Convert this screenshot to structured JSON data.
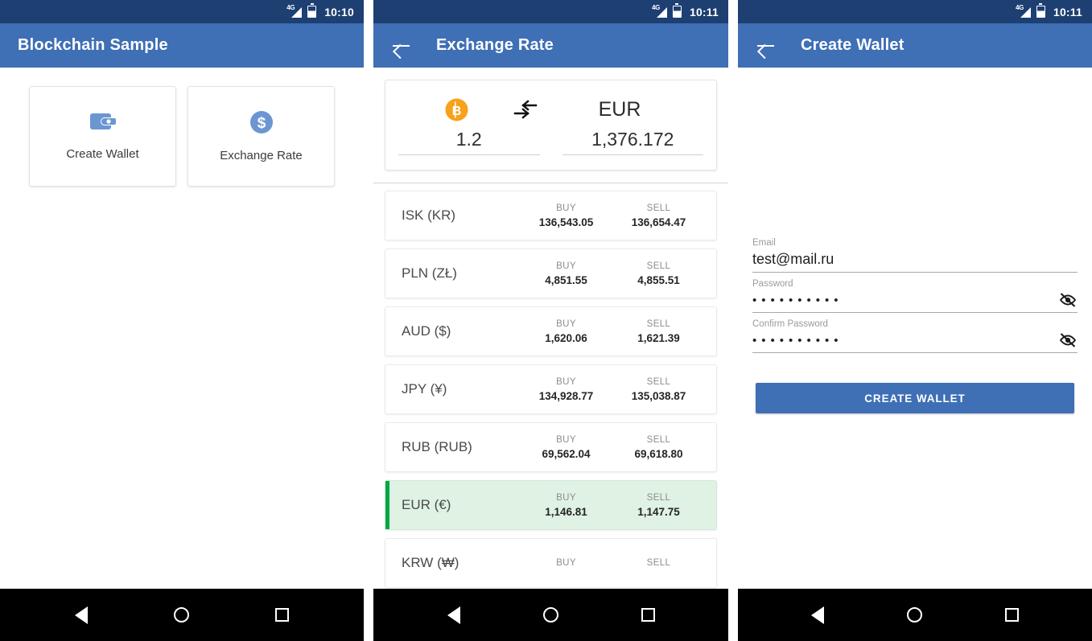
{
  "screens": {
    "home": {
      "statusbar": {
        "network": "4G",
        "time": "10:10",
        "signal_icon": "signal-4g-icon",
        "battery_icon": "battery-icon"
      },
      "appbar": {
        "title": "Blockchain Sample"
      },
      "cards": [
        {
          "label": "Create Wallet",
          "icon": "wallet-icon"
        },
        {
          "label": "Exchange Rate",
          "icon": "dollar-circle-icon"
        }
      ]
    },
    "exchange": {
      "statusbar": {
        "network": "4G",
        "time": "10:11",
        "signal_icon": "signal-4g-icon",
        "battery_icon": "battery-icon"
      },
      "appbar": {
        "title": "Exchange Rate",
        "back_icon": "back-arrow-icon"
      },
      "converter": {
        "from_icon": "bitcoin-icon",
        "swap_icon": "compare-arrows-icon",
        "to_currency": "EUR",
        "from_value": "1.2",
        "to_value": "1,376.172"
      },
      "columns": {
        "buy": "BUY",
        "sell": "SELL"
      },
      "rates": [
        {
          "currency": "ISK (KR)",
          "buy": "136,543.05",
          "sell": "136,654.47",
          "selected": false
        },
        {
          "currency": "PLN (ZŁ)",
          "buy": "4,851.55",
          "sell": "4,855.51",
          "selected": false
        },
        {
          "currency": "AUD ($)",
          "buy": "1,620.06",
          "sell": "1,621.39",
          "selected": false
        },
        {
          "currency": "JPY (¥)",
          "buy": "134,928.77",
          "sell": "135,038.87",
          "selected": false
        },
        {
          "currency": "RUB (RUB)",
          "buy": "69,562.04",
          "sell": "69,618.80",
          "selected": false
        },
        {
          "currency": "EUR (€)",
          "buy": "1,146.81",
          "sell": "1,147.75",
          "selected": true
        },
        {
          "currency": "KRW (₩)",
          "buy": "BUY",
          "sell": "SELL",
          "selected": false
        }
      ]
    },
    "create_wallet": {
      "statusbar": {
        "network": "4G",
        "time": "10:11",
        "signal_icon": "signal-4g-icon",
        "battery_icon": "battery-icon"
      },
      "appbar": {
        "title": "Create Wallet",
        "back_icon": "back-arrow-icon"
      },
      "form": {
        "email_label": "Email",
        "email_value": "test@mail.ru",
        "password_label": "Password",
        "password_value": "••••••••••",
        "confirm_label": "Confirm Password",
        "confirm_value": "••••••••••",
        "toggle_icon": "eye-off-icon",
        "submit_label": "CREATE WALLET"
      }
    }
  },
  "navbar": {
    "back": "nav-back-icon",
    "home": "nav-home-icon",
    "recents": "nav-recents-icon"
  },
  "colors": {
    "statusbar": "#1d3f72",
    "appbar": "#3f6fb5",
    "accent_green": "#00a843",
    "selected_row_bg": "#dff2e4",
    "bitcoin_orange": "#f7a21b",
    "icon_blue": "#6b96d2"
  }
}
